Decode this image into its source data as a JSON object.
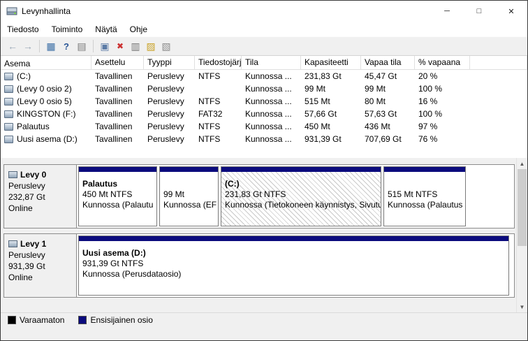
{
  "colors": {
    "primary_partition": "#0b0b7d",
    "unallocated": "#000000"
  },
  "window": {
    "title": "Levynhallinta",
    "controls": {
      "minimize": "─",
      "maximize": "□",
      "close": "✕"
    }
  },
  "menu": {
    "items": [
      "Tiedosto",
      "Toiminto",
      "Näytä",
      "Ohje"
    ]
  },
  "toolbar": {
    "icons": [
      {
        "name": "back",
        "glyph": "←"
      },
      {
        "name": "forward",
        "glyph": "→"
      },
      {
        "name": "console-tree",
        "glyph": "▦"
      },
      {
        "name": "help",
        "glyph": "?"
      },
      {
        "name": "export-list",
        "glyph": "▤"
      },
      {
        "name": "action-pane",
        "glyph": "▣"
      },
      {
        "name": "delete-volume",
        "glyph": "✖"
      },
      {
        "name": "new-volume",
        "glyph": "▥"
      },
      {
        "name": "open-explorer",
        "glyph": "▨"
      },
      {
        "name": "extend-volume",
        "glyph": "▧"
      }
    ]
  },
  "table": {
    "columns": [
      "Asema",
      "Asettelu",
      "Tyyppi",
      "Tiedostojärj...",
      "Tila",
      "Kapasiteetti",
      "Vapaa tila",
      "% vapaana"
    ],
    "rows": [
      [
        "(C:)",
        "Tavallinen",
        "Peruslevy",
        "NTFS",
        "Kunnossa ...",
        "231,83 Gt",
        "45,47 Gt",
        "20 %"
      ],
      [
        "(Levy 0 osio 2)",
        "Tavallinen",
        "Peruslevy",
        "",
        "Kunnossa ...",
        "99 Mt",
        "99 Mt",
        "100 %"
      ],
      [
        "(Levy 0 osio 5)",
        "Tavallinen",
        "Peruslevy",
        "NTFS",
        "Kunnossa ...",
        "515 Mt",
        "80 Mt",
        "16 %"
      ],
      [
        "KINGSTON (F:)",
        "Tavallinen",
        "Peruslevy",
        "FAT32",
        "Kunnossa ...",
        "57,66 Gt",
        "57,63 Gt",
        "100 %"
      ],
      [
        "Palautus",
        "Tavallinen",
        "Peruslevy",
        "NTFS",
        "Kunnossa ...",
        "450 Mt",
        "436 Mt",
        "97 %"
      ],
      [
        "Uusi asema (D:)",
        "Tavallinen",
        "Peruslevy",
        "NTFS",
        "Kunnossa ...",
        "931,39 Gt",
        "707,69 Gt",
        "76 %"
      ]
    ]
  },
  "disks": [
    {
      "name": "Levy 0",
      "type": "Peruslevy",
      "size": "232,87 Gt",
      "status": "Online",
      "partitions": [
        {
          "name": "Palautus",
          "size": "450 Mt NTFS",
          "status": "Kunnossa (Palautu"
        },
        {
          "name": "",
          "size": "99 Mt",
          "status": "Kunnossa (EF"
        },
        {
          "name": "(C:)",
          "size": "231,83 Gt NTFS",
          "status": "Kunnossa (Tietokoneen käynnistys, Sivutu"
        },
        {
          "name": "",
          "size": "515 Mt NTFS",
          "status": "Kunnossa (Palautus"
        }
      ]
    },
    {
      "name": "Levy 1",
      "type": "Peruslevy",
      "size": "931,39 Gt",
      "status": "Online",
      "partitions": [
        {
          "name": "Uusi asema  (D:)",
          "size": "931,39 Gt NTFS",
          "status": "Kunnossa (Perusdataosio)"
        }
      ]
    }
  ],
  "legend": {
    "items": [
      {
        "label": "Varaamaton"
      },
      {
        "label": "Ensisijainen osio"
      }
    ]
  }
}
